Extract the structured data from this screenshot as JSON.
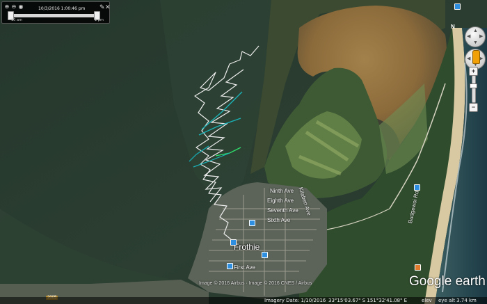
{
  "time_slider": {
    "current": "10/3/2016  1:00:46 pm",
    "start_label": "10 am",
    "end_label": "1 pm"
  },
  "compass": {
    "north_label": "N"
  },
  "zoom": {
    "plus": "+",
    "minus": "−"
  },
  "map_labels": {
    "town": "Frothie",
    "streets": [
      "Ninth Ave",
      "Eighth Ave",
      "Seventh Ave",
      "Sixth Ave",
      "Budgewoi Rd",
      "Kilaben Ave",
      "First Ave"
    ]
  },
  "attribution": {
    "copyright": "Image © 2016 Airbus · Image © 2016 CNES / Airbus",
    "imagery_date": "Imagery Date: 1/10/2016",
    "coords": "33°15'03.67\" S  151°32'41.08\" E",
    "elevation": "elev",
    "eye_alt": "eye alt  3.74 km",
    "year_badge": "2005",
    "logo_google": "Google",
    "logo_earth": "earth"
  },
  "colors": {
    "water_dark": "#25372c",
    "track_white": "#ececec",
    "track_teal": "#19b3b8",
    "track_green": "#2ee06c",
    "pin_blue": "#2e8fe0"
  },
  "icons": [
    "zoom-in-icon",
    "zoom-out-icon",
    "eye-icon",
    "wrench-icon",
    "close-icon",
    "pegman-icon"
  ]
}
